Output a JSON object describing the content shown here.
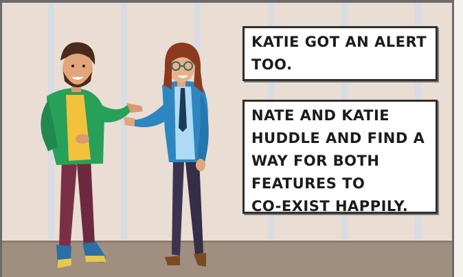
{
  "scene": {
    "colors": {
      "wall": "#e9ddd4",
      "stripe": "#d6dbe2",
      "floor": "#9f8e7e",
      "frame": "#5a5a5a"
    }
  },
  "characters": [
    {
      "name": "Nate",
      "colors": {
        "hoodie": "#27a05a",
        "shirt": "#f2c23b",
        "pants": "#7a2f45",
        "hair": "#4a2a1c"
      }
    },
    {
      "name": "Katie",
      "colors": {
        "blazer": "#2e86c1",
        "shirt": "#aedaf3",
        "pants": "#3b3450",
        "hair": "#8c3a1e"
      }
    }
  ],
  "captions": [
    {
      "text": "KATIE GOT AN ALERT\nTOO."
    },
    {
      "text": "NATE AND KATIE\nHUDDLE AND FIND A\nWAY FOR BOTH\nFEATURES TO\nCO-EXIST HAPPILY."
    }
  ]
}
